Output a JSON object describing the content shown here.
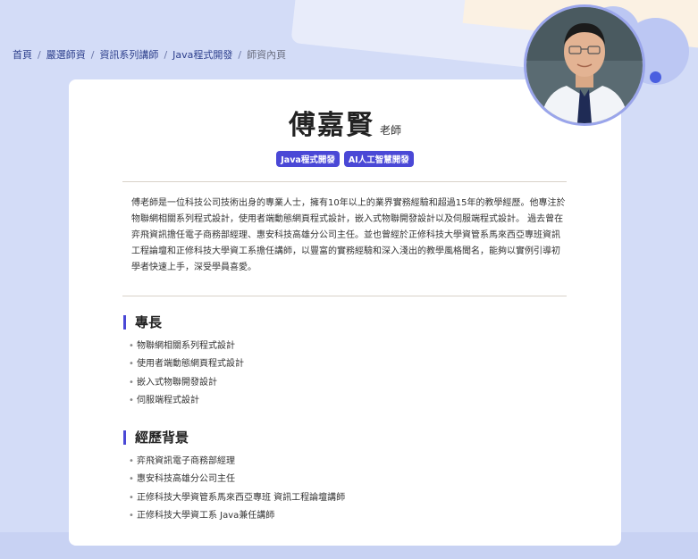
{
  "breadcrumb": {
    "items": [
      "首頁",
      "嚴選師資",
      "資訊系列講師",
      "Java程式開發"
    ],
    "current": "師資內頁"
  },
  "teacher": {
    "name": "傅嘉賢",
    "title": "老師",
    "tags": [
      "Java程式開發",
      "AI人工智慧開發"
    ],
    "bio": "傅老師是一位科技公司技術出身的專業人士，擁有10年以上的業界實務經驗和超過15年的教學經歷。他專注於物聯網相關系列程式設計，使用者端動態網頁程式設計，嵌入式物聯開發設計以及伺服端程式設計。 過去曾在弈飛資訊擔任電子商務部經理、惠安科技高雄分公司主任。並也曾經於正修科技大學資管系馬來西亞專班資訊工程論壇和正修科技大學資工系擔任講師，以豐富的實務經驗和深入淺出的教學風格聞名，能夠以實例引導初學者快速上手，深受學員喜愛。"
  },
  "expertise": {
    "heading": "專長",
    "items": [
      "物聯網相關系列程式設計",
      "使用者端動態網頁程式設計",
      "嵌入式物聯開發設計",
      "伺服端程式設計"
    ]
  },
  "experience": {
    "heading": "經歷背景",
    "items": [
      "弈飛資訊電子商務部經理",
      "惠安科技高雄分公司主任",
      "正修科技大學資管系馬來西亞專班 資訊工程論壇講師",
      "正修科技大學資工系 Java兼任講師"
    ]
  },
  "colors": {
    "accent": "#4a48d6",
    "background": "#d3dcf7"
  }
}
